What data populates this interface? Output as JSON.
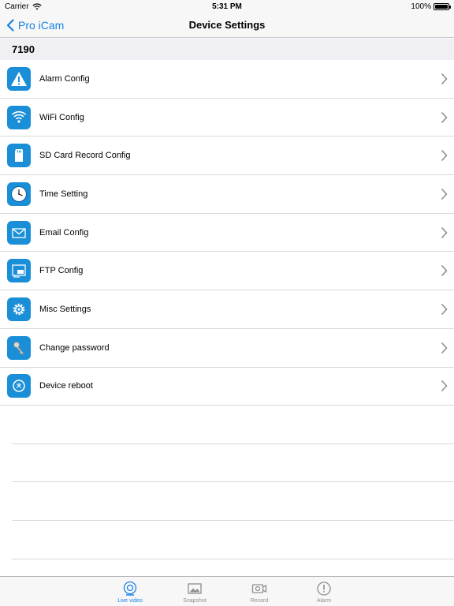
{
  "status_bar": {
    "carrier": "Carrier",
    "time": "5:31 PM",
    "battery": "100%"
  },
  "nav": {
    "back_label": "Pro iCam",
    "title": "Device Settings"
  },
  "section": {
    "header": "7190"
  },
  "items": [
    {
      "label": "Alarm Config",
      "icon": "warning-icon"
    },
    {
      "label": "WiFi Config",
      "icon": "wifi-icon"
    },
    {
      "label": "SD Card Record Config",
      "icon": "sd-card-icon"
    },
    {
      "label": "Time Setting",
      "icon": "clock-icon"
    },
    {
      "label": "Email Config",
      "icon": "envelope-icon"
    },
    {
      "label": "FTP Config",
      "icon": "ftp-icon"
    },
    {
      "label": "Misc Settings",
      "icon": "gear-icon"
    },
    {
      "label": "Change password",
      "icon": "key-icon"
    },
    {
      "label": "Device reboot",
      "icon": "reboot-icon"
    }
  ],
  "tab_bar": {
    "tabs": [
      {
        "label": "Live video",
        "icon": "camera-lens-icon",
        "active": true
      },
      {
        "label": "Snapshot",
        "icon": "picture-icon",
        "active": false
      },
      {
        "label": "Record",
        "icon": "video-camera-icon",
        "active": false
      },
      {
        "label": "Alarm",
        "icon": "alert-icon",
        "active": false
      }
    ]
  },
  "colors": {
    "accent": "#1a82e2",
    "icon_bg": "#1a8fd8",
    "separator": "#d9d9de"
  }
}
